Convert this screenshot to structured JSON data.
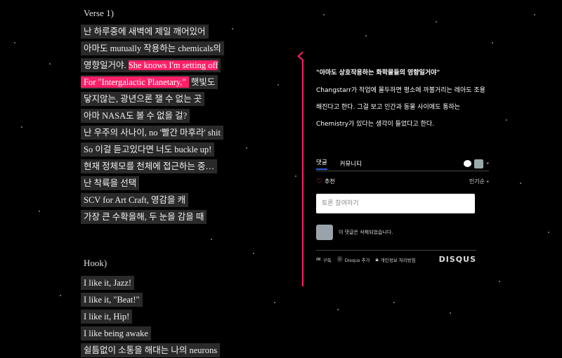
{
  "lyrics": {
    "verse_label": "Verse 1)",
    "verse_lines": [
      {
        "text": "난 하루중에 새벽에 제일 깨어있어"
      },
      {
        "text": "아마도 mutually 작용하는 chemicals의"
      },
      {
        "pre": "영향일거야. ",
        "highlight": "She knows I'm setting off"
      },
      {
        "highlight": "For \"Intergalactic Planetary,\"",
        "post": " 햇빛도"
      },
      {
        "text": "닿지않는, 광년으론 잴 수 없는 곳"
      },
      {
        "text": "아마 NASA도 볼 수 없을 걸?"
      },
      {
        "text": "난 우주의 사나이, no '빨간 마후라' shit"
      },
      {
        "text": "So 이걸 듣고있다면 너도 buckle up!"
      },
      {
        "text": "현재 정체모를 천체에 접근하는 중…"
      },
      {
        "text": "난 착륙을 선택"
      },
      {
        "text": "SCV for Art Craft, 영감을 캐"
      },
      {
        "text": "가장 큰 수확을해, 두 눈을 감을 때"
      }
    ],
    "hook_label": "Hook)",
    "hook_lines": [
      "I like it, Jazz!",
      "I like it, \"Beat!\"",
      "I like it, Hip!",
      "I like being awake",
      "쉴틈없이 소통을 해대는 나의 neurons"
    ]
  },
  "annotation": {
    "quote": "\"아마도 상호작용하는 화학물들의 영향일거야\"",
    "explanation": "Changstarr가 작업에 몰두하면 평소에 까불거리는 레아도 조용해진다고 한다. 그걸 보고 인간과 동물 사이에도 통하는 Chemistry가 있다는 생각이 들었다고 한다."
  },
  "comments": {
    "tab_comments": "댓글",
    "tab_community": "커뮤니티",
    "recommend": "추천",
    "sort": "인기순",
    "placeholder": "토론 참여하기",
    "deleted_comment": "이 댓글은 삭제되었습니다.",
    "footer": {
      "subscribe": "구독",
      "add_disqus": "Disqus 추가",
      "privacy": "개인정보 처리방침",
      "brand": "DISQUS"
    }
  },
  "colors": {
    "accent": "#ff1f67",
    "tab_underline": "#2e5bd6",
    "background": "#000000"
  },
  "icons": [
    "heart-icon",
    "chat-bubble-icon",
    "avatar-icon",
    "mail-icon",
    "disqus-d-icon",
    "lock-icon",
    "chevron-down-icon"
  ]
}
